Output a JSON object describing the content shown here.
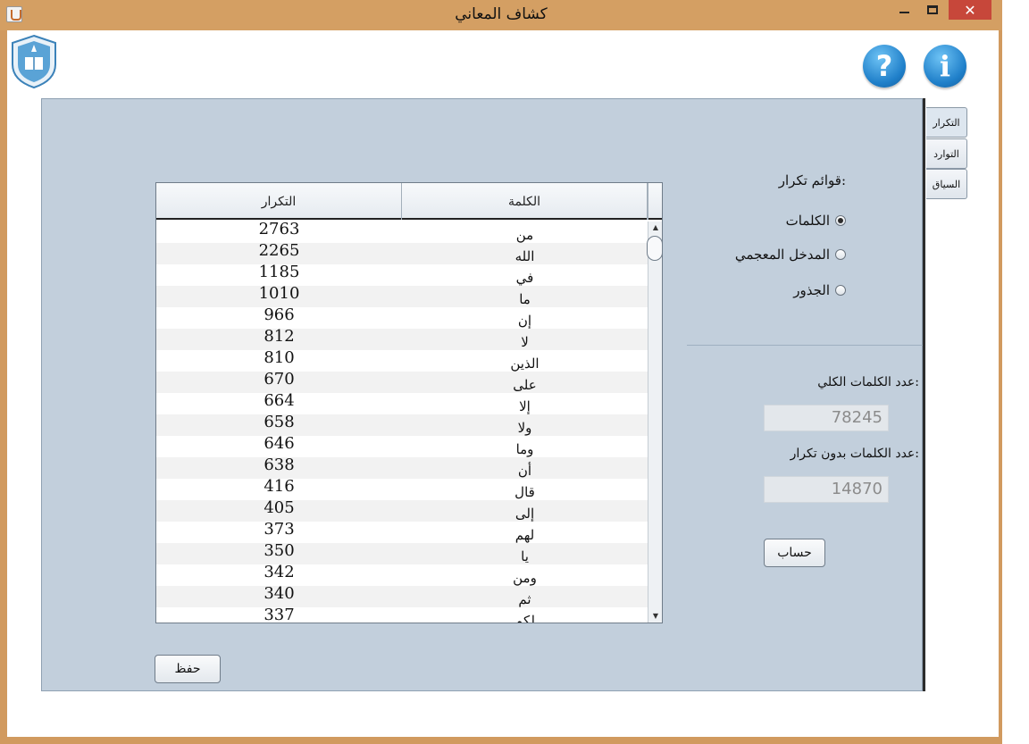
{
  "window": {
    "title": "كشاف المعاني",
    "minimize_label": "—",
    "maximize_label": "☐",
    "close_label": "✕"
  },
  "toolbar": {
    "help_label": "?",
    "info_label": "i"
  },
  "side_tabs": [
    {
      "label": "التكرار"
    },
    {
      "label": "التوارد"
    },
    {
      "label": "السياق"
    }
  ],
  "table": {
    "columns": [
      "التكرار",
      "الكلمة"
    ],
    "rows": [
      {
        "count": "2763",
        "word": "من"
      },
      {
        "count": "2265",
        "word": "الله"
      },
      {
        "count": "1185",
        "word": "في"
      },
      {
        "count": "1010",
        "word": "ما"
      },
      {
        "count": "966",
        "word": "إن"
      },
      {
        "count": "812",
        "word": "لا"
      },
      {
        "count": "810",
        "word": "الذين"
      },
      {
        "count": "670",
        "word": "على"
      },
      {
        "count": "664",
        "word": "إلا"
      },
      {
        "count": "658",
        "word": "ولا"
      },
      {
        "count": "646",
        "word": "وما"
      },
      {
        "count": "638",
        "word": "أن"
      },
      {
        "count": "416",
        "word": "قال"
      },
      {
        "count": "405",
        "word": "إلى"
      },
      {
        "count": "373",
        "word": "لهم"
      },
      {
        "count": "350",
        "word": "يا"
      },
      {
        "count": "342",
        "word": "ومن"
      },
      {
        "count": "340",
        "word": "ثم"
      },
      {
        "count": "337",
        "word": "لكم"
      }
    ]
  },
  "buttons": {
    "save": "حفظ",
    "calculate": "حساب"
  },
  "lists": {
    "title": "قوائم تكرار:",
    "options": [
      {
        "label": "الكلمات",
        "checked": true
      },
      {
        "label": "المدخل المعجمي",
        "checked": false
      },
      {
        "label": "الجذور",
        "checked": false
      }
    ]
  },
  "stats": {
    "total_label": "عدد الكلمات الكلي:",
    "total_value": "78245",
    "unique_label": "عدد الكلمات بدون تكرار:",
    "unique_value": "14870"
  },
  "colors": {
    "titlebar": "#d49f63",
    "panel": "#c2cfdc",
    "close_button": "#c7473a",
    "icon_blue": "#1f7fc9"
  }
}
